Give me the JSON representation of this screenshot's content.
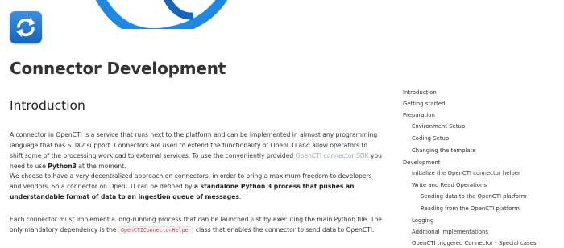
{
  "header": {
    "logo_icon": "sync-arrows-icon",
    "banner_color": "#1e88e5",
    "logo_color": "#1976d2"
  },
  "page": {
    "title": "Connector Development"
  },
  "section": {
    "title": "Introduction"
  },
  "paragraphs": {
    "p1": {
      "t1": "A connector in OpenCTI is a service that runs next to the platform and can be implemented in almost any programming language that has STIX2 support. Connectors are used to extend the functionality of OpenCTI and allow operators to shift some of the processing workload to external services. To use the conveniently provided ",
      "link": "OpenCTI connector SDK",
      "t2": " you need to use ",
      "bold": "Python3",
      "t3": " at the moment."
    },
    "p2": {
      "t1": "We choose to have a very decentralized approach on connectors, in order to bring a maximum freedom to developers and vendors. So a connector on OpenCTI can be defined by ",
      "bold": "a standalone Python 3 process that pushes an understandable format of data to an ingestion queue of messages",
      "t2": "."
    },
    "p3": {
      "t1": "Each connector must implement a long-running process that can be launched just by executing the main Python file. The only mandatory dependency is the ",
      "code": "OpenCTIConnectorHelper",
      "t2": " class that enables the connector to send data to OpenCTI."
    }
  },
  "toc": {
    "items": [
      {
        "label": "Introduction"
      },
      {
        "label": "Getting started"
      },
      {
        "label": "Preparation"
      },
      {
        "label": "Environment Setup"
      },
      {
        "label": "Coding Setup"
      },
      {
        "label": "Changing the template"
      },
      {
        "label": "Development"
      },
      {
        "label": "Initialize the OpenCTI connector helper"
      },
      {
        "label": "Write and Read Operations"
      },
      {
        "label": "Sending data to the OpenCTI platform"
      },
      {
        "label": "Reading from the OpenCTI platform"
      },
      {
        "label": "Logging"
      },
      {
        "label": "Additional implementations"
      },
      {
        "label": "OpenCTI triggered Connector - Special cases"
      }
    ]
  }
}
